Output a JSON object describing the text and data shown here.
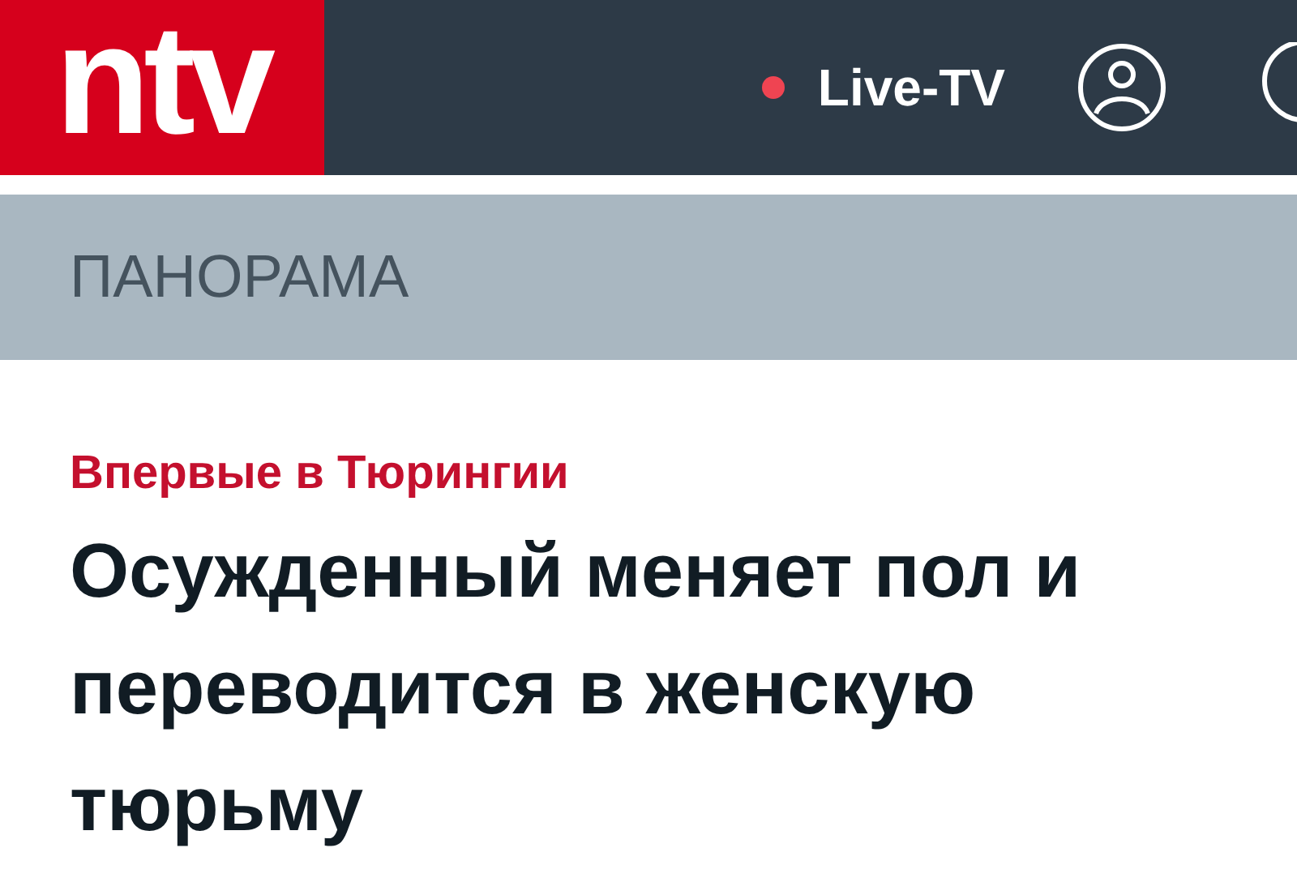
{
  "header": {
    "logo": "ntv",
    "live_link": "Live-TV"
  },
  "section": {
    "title": "ПАНОРАМА"
  },
  "article": {
    "kicker": "Впервые в Тюрингии",
    "headline": "Осужденный меняет пол и переводится в женскую тюрьму"
  }
}
